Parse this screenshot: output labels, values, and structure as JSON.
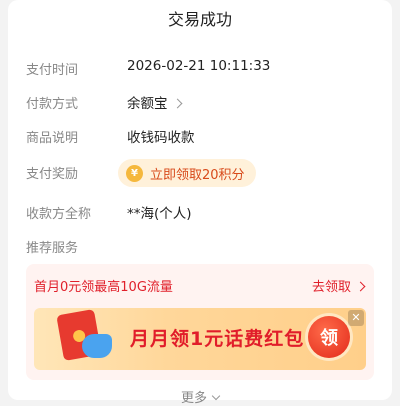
{
  "header": {
    "title": "交易成功"
  },
  "details": [
    {
      "label": "支付时间",
      "value": "2026-02-21 10:11:33"
    },
    {
      "label": "付款方式",
      "value": "余额宝"
    },
    {
      "label": "商品说明",
      "value": "收钱码收款"
    },
    {
      "label": "支付奖励",
      "value": "立即领取20积分"
    },
    {
      "label": "收款方全称",
      "value": "**海(个人)"
    },
    {
      "label": "推荐服务",
      "value": ""
    }
  ],
  "promo": {
    "title": "首月0元领最高10G流量",
    "link_label": "去领取",
    "banner_text": "月月领1元话费红包",
    "claim_button": "领",
    "close_label": "✕"
  },
  "footer": {
    "more_label": "更多"
  },
  "colors": {
    "accent_red": "#e0202b",
    "reward_text": "#d84a1b",
    "reward_bg": "#fff1da"
  },
  "icons": {
    "reward": "coin-icon",
    "chevron": "chevron-right-icon",
    "more": "chevron-down-icon"
  }
}
